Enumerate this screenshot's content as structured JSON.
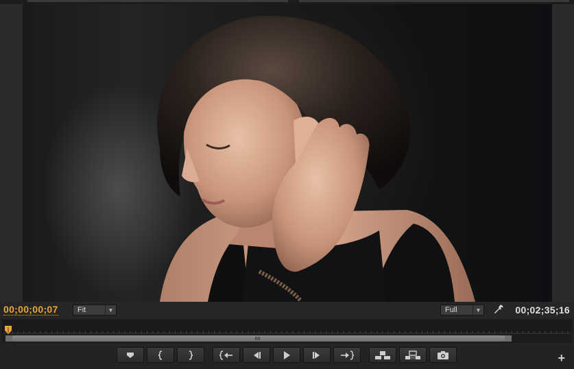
{
  "timecodes": {
    "current": "00;00;00;07",
    "duration": "00;02;35;16"
  },
  "zoom": {
    "selected": "Fit"
  },
  "playback_resolution": {
    "selected": "Full"
  },
  "transport_buttons": [
    {
      "name": "add-marker-button",
      "icon": "marker-icon"
    },
    {
      "name": "mark-in-button",
      "icon": "mark-in-icon"
    },
    {
      "name": "mark-out-button",
      "icon": "mark-out-icon"
    },
    {
      "name": "go-to-in-button",
      "icon": "go-to-in-icon"
    },
    {
      "name": "step-back-button",
      "icon": "step-back-icon"
    },
    {
      "name": "play-button",
      "icon": "play-icon"
    },
    {
      "name": "step-forward-button",
      "icon": "step-forward-icon"
    },
    {
      "name": "go-to-out-button",
      "icon": "go-to-out-icon"
    },
    {
      "name": "insert-button",
      "icon": "insert-icon"
    },
    {
      "name": "overwrite-button",
      "icon": "overwrite-icon"
    },
    {
      "name": "export-frame-button",
      "icon": "camera-icon"
    }
  ],
  "colors": {
    "current_timecode": "#e9a63a",
    "panel_bg": "#232323"
  }
}
